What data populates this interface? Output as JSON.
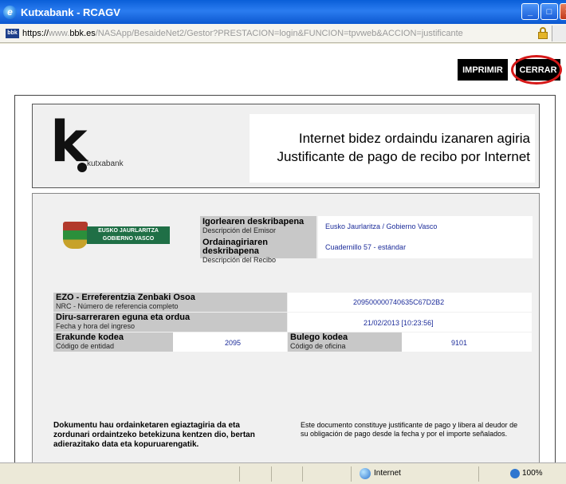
{
  "window": {
    "title": "Kutxabank - RCAGV",
    "ie_logo_icon": "e",
    "min_icon": "_",
    "max_icon": "□",
    "close_icon": "✕"
  },
  "address": {
    "badge": "bbk",
    "scheme": "https://",
    "host_prefix": "www.",
    "host": "bbk.es",
    "path": "/NASApp/BesaideNet2/Gestor?PRESTACION=login&FUNCION=tpvweb&ACCION=justificante"
  },
  "actions": {
    "print_label": "IMPRIMIR",
    "close_label": "CERRAR"
  },
  "header": {
    "brand_letter": "k",
    "brand_word": "kutxabank",
    "title_eu": "Internet bidez ordaindu izanaren agiria",
    "title_es": "Justificante de pago de recibo por Internet"
  },
  "issuer": {
    "logo_line1": "EUSKO JAURLARITZA",
    "logo_line2": "GOBIERNO VASCO",
    "emitter_label_eu": "Igorlearen deskribapena",
    "emitter_label_es": "Descripción del Emisor",
    "emitter_value": "Eusko Jaurlaritza / Gobierno Vasco",
    "receipt_label_eu": "Ordainagiriaren deskribapena",
    "receipt_label_es": "Descripción del Recibo",
    "receipt_value": "Cuadernillo 57 - estándar"
  },
  "details": {
    "nrc_label_eu": "EZO - Erreferentzia Zenbaki Osoa",
    "nrc_label_es": "NRC - Número de referencia completo",
    "nrc_value": "209500000740635C67D2B2",
    "date_label_eu": "Diru-sarreraren eguna eta ordua",
    "date_label_es": "Fecha y hora del ingreso",
    "date_value": "21/02/2013 [10:23:56]",
    "entity_label_eu": "Erakunde kodea",
    "entity_label_es": "Código de entidad",
    "entity_value": "2095",
    "office_label_eu": "Bulego kodea",
    "office_label_es": "Código de oficina",
    "office_value": "9101"
  },
  "footer": {
    "text_eu": "Dokumentu hau ordainketaren egiaztagiria da eta zordunari ordaintzeko betekizuna kentzen dio, bertan adierazitako data eta kopuruarengatik.",
    "text_es": "Este documento constituye justificante de pago y libera al deudor de su obligación de pago desde la fecha y por el importe señalados."
  },
  "status": {
    "zone": "Internet",
    "zoom": "100%"
  }
}
